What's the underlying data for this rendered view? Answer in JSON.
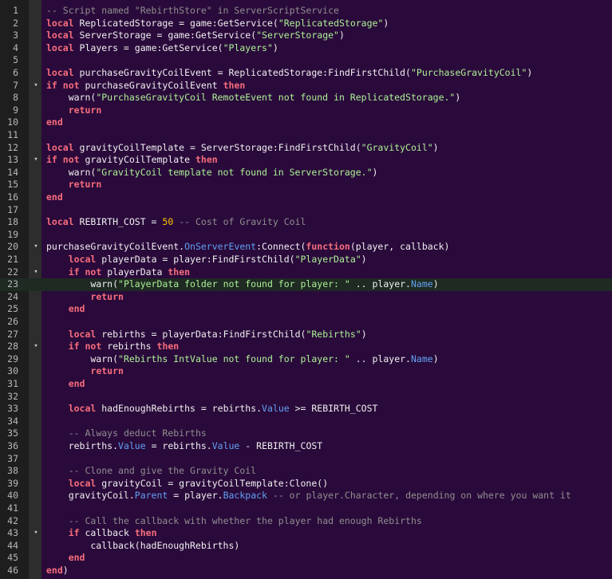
{
  "editor": {
    "current_line": 23,
    "lines": [
      {
        "n": "1",
        "fold": "",
        "tokens": [
          [
            "cm",
            "-- Script named \"RebirthStore\" in ServerScriptService"
          ]
        ]
      },
      {
        "n": "2",
        "fold": "",
        "tokens": [
          [
            "kw",
            "local"
          ],
          [
            "id",
            " ReplicatedStorage = "
          ],
          [
            "id",
            "game"
          ],
          [
            "op",
            ":GetService("
          ],
          [
            "str",
            "\"ReplicatedStorage\""
          ],
          [
            "op",
            ")"
          ]
        ]
      },
      {
        "n": "3",
        "fold": "",
        "tokens": [
          [
            "kw",
            "local"
          ],
          [
            "id",
            " ServerStorage = "
          ],
          [
            "id",
            "game"
          ],
          [
            "op",
            ":GetService("
          ],
          [
            "str",
            "\"ServerStorage\""
          ],
          [
            "op",
            ")"
          ]
        ]
      },
      {
        "n": "4",
        "fold": "",
        "tokens": [
          [
            "kw",
            "local"
          ],
          [
            "id",
            " Players = "
          ],
          [
            "id",
            "game"
          ],
          [
            "op",
            ":GetService("
          ],
          [
            "str",
            "\"Players\""
          ],
          [
            "op",
            ")"
          ]
        ]
      },
      {
        "n": "5",
        "fold": "",
        "tokens": []
      },
      {
        "n": "6",
        "fold": "",
        "tokens": [
          [
            "kw",
            "local"
          ],
          [
            "id",
            " purchaseGravityCoilEvent = ReplicatedStorage:FindFirstChild("
          ],
          [
            "str",
            "\"PurchaseGravityCoil\""
          ],
          [
            "op",
            ")"
          ]
        ]
      },
      {
        "n": "7",
        "fold": "▾",
        "tokens": [
          [
            "kw",
            "if"
          ],
          [
            "id",
            " "
          ],
          [
            "kw",
            "not"
          ],
          [
            "id",
            " purchaseGravityCoilEvent "
          ],
          [
            "kw",
            "then"
          ]
        ]
      },
      {
        "n": "8",
        "fold": "",
        "tokens": [
          [
            "id",
            "    warn("
          ],
          [
            "str",
            "\"PurchaseGravityCoil RemoteEvent not found in ReplicatedStorage.\""
          ],
          [
            "op",
            ")"
          ]
        ]
      },
      {
        "n": "9",
        "fold": "",
        "tokens": [
          [
            "id",
            "    "
          ],
          [
            "kw",
            "return"
          ]
        ]
      },
      {
        "n": "10",
        "fold": "",
        "tokens": [
          [
            "kw",
            "end"
          ]
        ]
      },
      {
        "n": "11",
        "fold": "",
        "tokens": []
      },
      {
        "n": "12",
        "fold": "",
        "tokens": [
          [
            "kw",
            "local"
          ],
          [
            "id",
            " gravityCoilTemplate = ServerStorage:FindFirstChild("
          ],
          [
            "str",
            "\"GravityCoil\""
          ],
          [
            "op",
            ")"
          ]
        ]
      },
      {
        "n": "13",
        "fold": "▾",
        "tokens": [
          [
            "kw",
            "if"
          ],
          [
            "id",
            " "
          ],
          [
            "kw",
            "not"
          ],
          [
            "id",
            " gravityCoilTemplate "
          ],
          [
            "kw",
            "then"
          ]
        ]
      },
      {
        "n": "14",
        "fold": "",
        "tokens": [
          [
            "id",
            "    warn("
          ],
          [
            "str",
            "\"GravityCoil template not found in ServerStorage.\""
          ],
          [
            "op",
            ")"
          ]
        ]
      },
      {
        "n": "15",
        "fold": "",
        "tokens": [
          [
            "id",
            "    "
          ],
          [
            "kw",
            "return"
          ]
        ]
      },
      {
        "n": "16",
        "fold": "",
        "tokens": [
          [
            "kw",
            "end"
          ]
        ]
      },
      {
        "n": "17",
        "fold": "",
        "tokens": []
      },
      {
        "n": "18",
        "fold": "",
        "tokens": [
          [
            "kw",
            "local"
          ],
          [
            "id",
            " REBIRTH_COST = "
          ],
          [
            "num",
            "50"
          ],
          [
            "id",
            " "
          ],
          [
            "cm",
            "-- Cost of Gravity Coil"
          ]
        ]
      },
      {
        "n": "19",
        "fold": "",
        "tokens": []
      },
      {
        "n": "20",
        "fold": "▾",
        "tokens": [
          [
            "id",
            "purchaseGravityCoilEvent."
          ],
          [
            "prop",
            "OnServerEvent"
          ],
          [
            "id",
            ":Connect("
          ],
          [
            "kw",
            "function"
          ],
          [
            "id",
            "(player, callback)"
          ]
        ]
      },
      {
        "n": "21",
        "fold": "",
        "tokens": [
          [
            "id",
            "    "
          ],
          [
            "kw",
            "local"
          ],
          [
            "id",
            " playerData = player:FindFirstChild("
          ],
          [
            "str",
            "\"PlayerData\""
          ],
          [
            "op",
            ")"
          ]
        ]
      },
      {
        "n": "22",
        "fold": "▾",
        "tokens": [
          [
            "id",
            "    "
          ],
          [
            "kw",
            "if"
          ],
          [
            "id",
            " "
          ],
          [
            "kw",
            "not"
          ],
          [
            "id",
            " playerData "
          ],
          [
            "kw",
            "then"
          ]
        ]
      },
      {
        "n": "23",
        "fold": "",
        "tokens": [
          [
            "id",
            "        warn("
          ],
          [
            "str",
            "\"PlayerData folder not found for player: \""
          ],
          [
            "id",
            " .. player."
          ],
          [
            "prop",
            "Name"
          ],
          [
            "op",
            ")"
          ]
        ]
      },
      {
        "n": "24",
        "fold": "",
        "tokens": [
          [
            "id",
            "        "
          ],
          [
            "kw",
            "return"
          ]
        ]
      },
      {
        "n": "25",
        "fold": "",
        "tokens": [
          [
            "id",
            "    "
          ],
          [
            "kw",
            "end"
          ]
        ]
      },
      {
        "n": "26",
        "fold": "",
        "tokens": []
      },
      {
        "n": "27",
        "fold": "",
        "tokens": [
          [
            "id",
            "    "
          ],
          [
            "kw",
            "local"
          ],
          [
            "id",
            " rebirths = playerData:FindFirstChild("
          ],
          [
            "str",
            "\"Rebirths\""
          ],
          [
            "op",
            ")"
          ]
        ]
      },
      {
        "n": "28",
        "fold": "▾",
        "tokens": [
          [
            "id",
            "    "
          ],
          [
            "kw",
            "if"
          ],
          [
            "id",
            " "
          ],
          [
            "kw",
            "not"
          ],
          [
            "id",
            " rebirths "
          ],
          [
            "kw",
            "then"
          ]
        ]
      },
      {
        "n": "29",
        "fold": "",
        "tokens": [
          [
            "id",
            "        warn("
          ],
          [
            "str",
            "\"Rebirths IntValue not found for player: \""
          ],
          [
            "id",
            " .. player."
          ],
          [
            "prop",
            "Name"
          ],
          [
            "op",
            ")"
          ]
        ]
      },
      {
        "n": "30",
        "fold": "",
        "tokens": [
          [
            "id",
            "        "
          ],
          [
            "kw",
            "return"
          ]
        ]
      },
      {
        "n": "31",
        "fold": "",
        "tokens": [
          [
            "id",
            "    "
          ],
          [
            "kw",
            "end"
          ]
        ]
      },
      {
        "n": "32",
        "fold": "",
        "tokens": []
      },
      {
        "n": "33",
        "fold": "",
        "tokens": [
          [
            "id",
            "    "
          ],
          [
            "kw",
            "local"
          ],
          [
            "id",
            " hadEnoughRebirths = rebirths."
          ],
          [
            "prop",
            "Value"
          ],
          [
            "id",
            " >= REBIRTH_COST"
          ]
        ]
      },
      {
        "n": "34",
        "fold": "",
        "tokens": []
      },
      {
        "n": "35",
        "fold": "",
        "tokens": [
          [
            "id",
            "    "
          ],
          [
            "cm",
            "-- Always deduct Rebirths"
          ]
        ]
      },
      {
        "n": "36",
        "fold": "",
        "tokens": [
          [
            "id",
            "    rebirths."
          ],
          [
            "prop",
            "Value"
          ],
          [
            "id",
            " = rebirths."
          ],
          [
            "prop",
            "Value"
          ],
          [
            "id",
            " - REBIRTH_COST"
          ]
        ]
      },
      {
        "n": "37",
        "fold": "",
        "tokens": []
      },
      {
        "n": "38",
        "fold": "",
        "tokens": [
          [
            "id",
            "    "
          ],
          [
            "cm",
            "-- Clone and give the Gravity Coil"
          ]
        ]
      },
      {
        "n": "39",
        "fold": "",
        "tokens": [
          [
            "id",
            "    "
          ],
          [
            "kw",
            "local"
          ],
          [
            "id",
            " gravityCoil = gravityCoilTemplate:Clone()"
          ]
        ]
      },
      {
        "n": "40",
        "fold": "",
        "tokens": [
          [
            "id",
            "    gravityCoil."
          ],
          [
            "prop",
            "Parent"
          ],
          [
            "id",
            " = player."
          ],
          [
            "prop",
            "Backpack"
          ],
          [
            "id",
            " "
          ],
          [
            "cm",
            "-- or player.Character, depending on where you want it"
          ]
        ]
      },
      {
        "n": "41",
        "fold": "",
        "tokens": []
      },
      {
        "n": "42",
        "fold": "",
        "tokens": [
          [
            "id",
            "    "
          ],
          [
            "cm",
            "-- Call the callback with whether the player had enough Rebirths"
          ]
        ]
      },
      {
        "n": "43",
        "fold": "▾",
        "tokens": [
          [
            "id",
            "    "
          ],
          [
            "kw",
            "if"
          ],
          [
            "id",
            " callback "
          ],
          [
            "kw",
            "then"
          ]
        ]
      },
      {
        "n": "44",
        "fold": "",
        "tokens": [
          [
            "id",
            "        callback(hadEnoughRebirths)"
          ]
        ]
      },
      {
        "n": "45",
        "fold": "",
        "tokens": [
          [
            "id",
            "    "
          ],
          [
            "kw",
            "end"
          ]
        ]
      },
      {
        "n": "46",
        "fold": "",
        "tokens": [
          [
            "kw",
            "end"
          ],
          [
            "id",
            ")"
          ]
        ]
      }
    ]
  }
}
